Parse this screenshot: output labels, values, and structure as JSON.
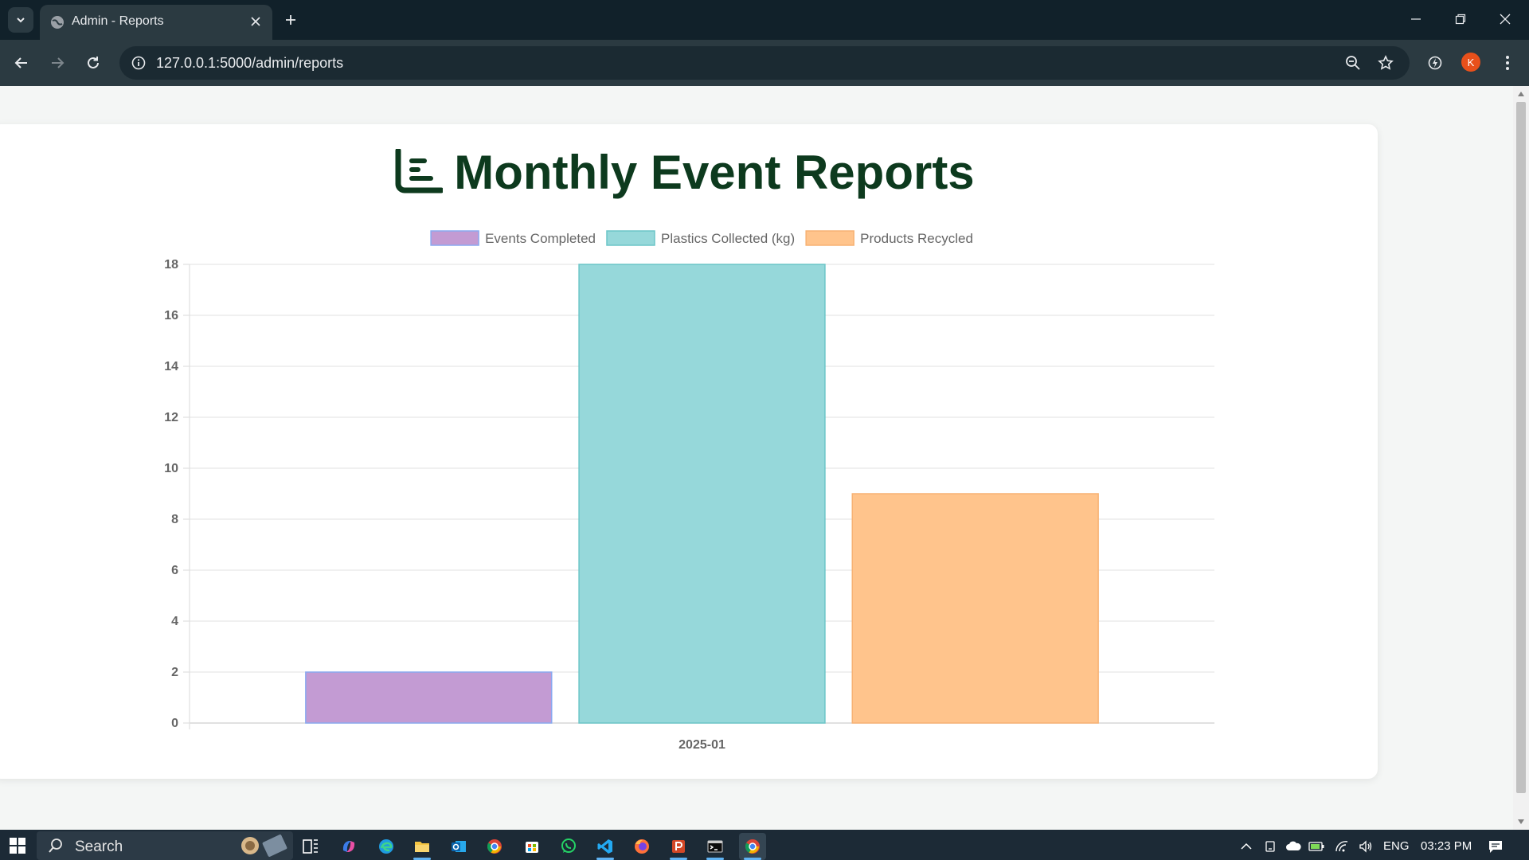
{
  "browser": {
    "tab_title": "Admin - Reports",
    "url": "127.0.0.1:5000/admin/reports",
    "profile_initial": "K"
  },
  "page": {
    "title": "Monthly Event Reports"
  },
  "chart_data": {
    "type": "bar",
    "title": "",
    "xlabel": "",
    "ylabel": "",
    "categories": [
      "2025-01"
    ],
    "ylim": [
      0,
      18
    ],
    "yticks": [
      0,
      2,
      4,
      6,
      8,
      10,
      12,
      14,
      16,
      18
    ],
    "grid": true,
    "legend_position": "top",
    "series": [
      {
        "name": "Events Completed",
        "values": [
          2
        ],
        "color": "#c39bd3",
        "border": "#8aa9f0"
      },
      {
        "name": "Plastics Collected (kg)",
        "values": [
          18
        ],
        "color": "#96d8da",
        "border": "#6cc6c8"
      },
      {
        "name": "Products Recycled",
        "values": [
          9
        ],
        "color": "#ffc48c",
        "border": "#f7b274"
      }
    ]
  },
  "taskbar": {
    "search_placeholder": "Search",
    "language": "ENG",
    "time": "03:23 PM"
  }
}
